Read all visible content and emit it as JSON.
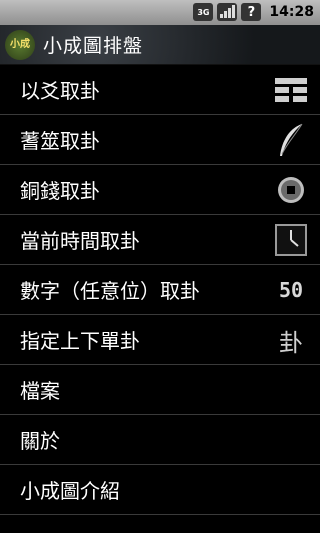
{
  "status_bar": {
    "network": "3G",
    "time": "14:28"
  },
  "title_bar": {
    "logo_text": "小成",
    "title": "小成圖排盤"
  },
  "menu": [
    {
      "label": "以爻取卦",
      "icon": "hexagram-icon"
    },
    {
      "label": "蓍筮取卦",
      "icon": "feather-icon"
    },
    {
      "label": "銅錢取卦",
      "icon": "coin-icon"
    },
    {
      "label": "當前時間取卦",
      "icon": "clock-icon"
    },
    {
      "label": "數字（任意位）取卦",
      "icon": "number-icon",
      "icon_text": "50"
    },
    {
      "label": "指定上下單卦",
      "icon": "trigram-icon",
      "icon_text": "卦"
    },
    {
      "label": "檔案"
    },
    {
      "label": "關於"
    },
    {
      "label": "小成圖介紹"
    }
  ]
}
